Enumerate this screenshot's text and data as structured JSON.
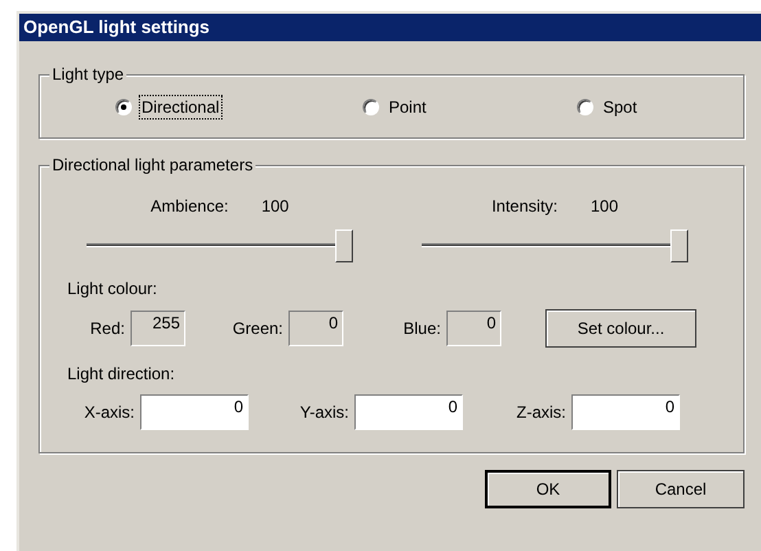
{
  "window": {
    "title": "OpenGL light settings"
  },
  "light_type": {
    "label": "Light type",
    "options": [
      {
        "label": "Directional",
        "selected": true
      },
      {
        "label": "Point",
        "selected": false
      },
      {
        "label": "Spot",
        "selected": false
      }
    ]
  },
  "parameters": {
    "label": "Directional light parameters",
    "sliders": [
      {
        "label": "Ambience:",
        "reading": "100",
        "level": 1
      },
      {
        "label": "Intensity:",
        "reading": "100",
        "level": 1
      }
    ],
    "colour_label": "Light colour:",
    "colour_fields": [
      {
        "label": "Red:",
        "value": "255",
        "disabled": true
      },
      {
        "label": "Green:",
        "value": "0",
        "disabled": true
      },
      {
        "label": "Blue:",
        "value": "0",
        "disabled": true
      }
    ],
    "set_colour_button": "Set colour...",
    "direction_label": "Light direction:",
    "direction_fields": [
      {
        "label": "X-axis:",
        "value": "0",
        "disabled": false
      },
      {
        "label": "Y-axis:",
        "value": "0",
        "disabled": false
      },
      {
        "label": "Z-axis:",
        "value": "0",
        "disabled": false
      }
    ]
  },
  "buttons": [
    {
      "label": "OK",
      "default": true
    },
    {
      "label": "Cancel",
      "default": false
    }
  ]
}
